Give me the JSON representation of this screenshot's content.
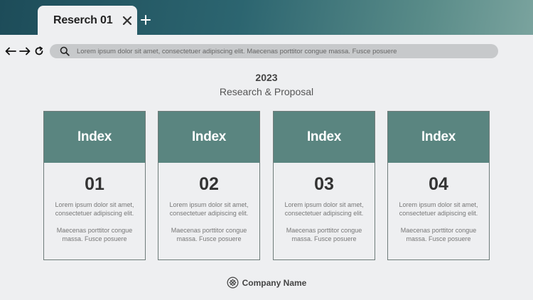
{
  "tab": {
    "title": "Reserch 01"
  },
  "address_bar": {
    "text": "Lorem ipsum dolor sit amet, consectetuer adipiscing elit. Maecenas porttitor congue massa. Fusce posuere"
  },
  "header": {
    "year": "2023",
    "subtitle": "Research & Proposal"
  },
  "cards": [
    {
      "title": "Index",
      "number": "01",
      "text1": "Lorem ipsum dolor sit amet, consectetuer adipiscing elit.",
      "text2": "Maecenas porttitor congue massa. Fusce posuere"
    },
    {
      "title": "Index",
      "number": "02",
      "text1": "Lorem ipsum dolor sit amet, consectetuer adipiscing elit.",
      "text2": "Maecenas porttitor congue massa. Fusce posuere"
    },
    {
      "title": "Index",
      "number": "03",
      "text1": "Lorem ipsum dolor sit amet, consectetuer adipiscing elit.",
      "text2": "Maecenas porttitor congue massa. Fusce posuere"
    },
    {
      "title": "Index",
      "number": "04",
      "text1": "Lorem ipsum dolor sit amet, consectetuer adipiscing elit.",
      "text2": "Maecenas porttitor congue massa. Fusce posuere"
    }
  ],
  "footer": {
    "company": "Company Name"
  },
  "icons": {
    "close": "close-icon",
    "new_tab": "plus-icon",
    "back": "arrow-left-icon",
    "forward": "arrow-right-icon",
    "reload": "reload-icon",
    "search": "search-icon",
    "logo": "company-logo-icon"
  },
  "colors": {
    "accent": "#5a8580",
    "topbar": "#1d4c59",
    "background": "#eeeff1"
  }
}
